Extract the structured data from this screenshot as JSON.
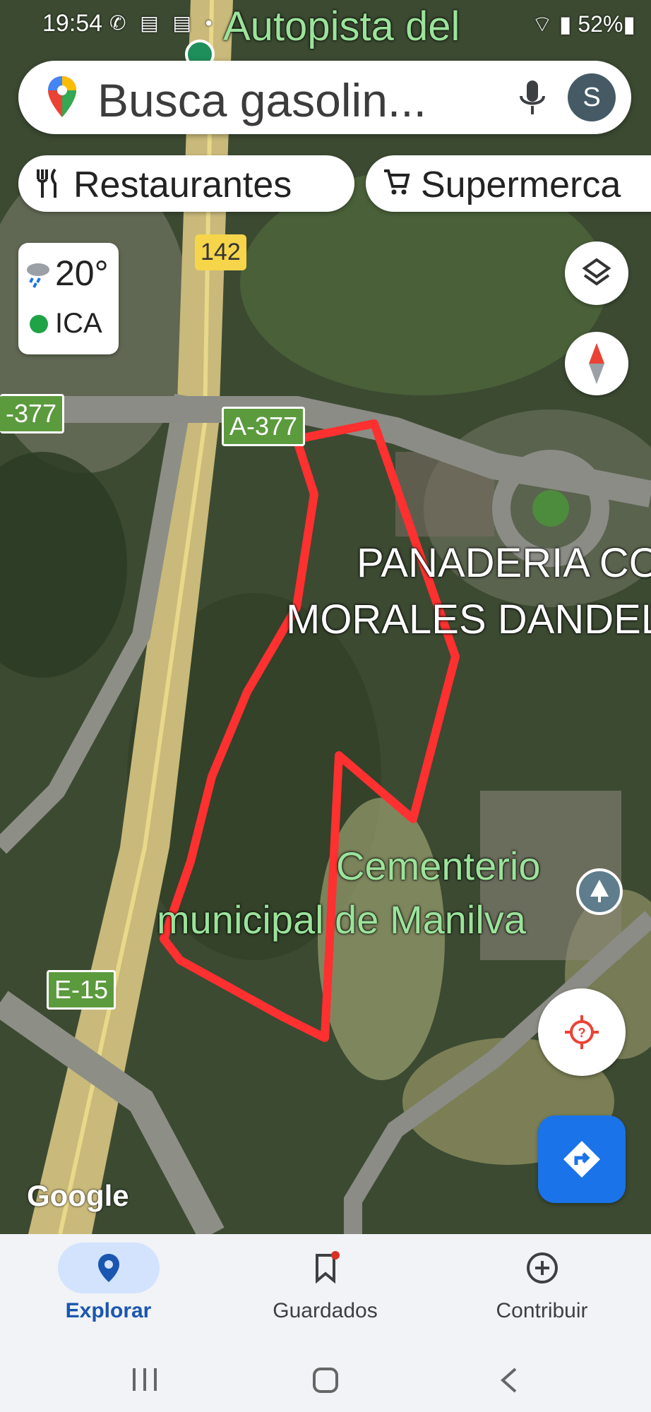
{
  "status_bar": {
    "time": "19:54",
    "battery": "52%"
  },
  "map_labels": {
    "top_road": "Autopista del",
    "bakery_line1": "PANADERIA CO",
    "bakery_line2": "MORALES DANDEL",
    "cemetery_line1": "Cementerio",
    "cemetery_line2": "municipal de Manilva"
  },
  "road_shields": {
    "a377_left": "-377",
    "a377_main": "A-377",
    "route_142": "142",
    "e15": "E-15"
  },
  "search": {
    "placeholder": "Busca gasolin...",
    "avatar_initial": "S"
  },
  "chips": [
    {
      "label": "Restaurantes",
      "icon": "fork-knife-icon"
    },
    {
      "label": "Supermerca",
      "icon": "shopping-cart-icon"
    }
  ],
  "weather": {
    "temperature": "20°",
    "air_quality": "ICA",
    "icon": "rain-cloud-icon",
    "air_quality_color": "#1ea446"
  },
  "attribution": "Google",
  "bottom_nav": [
    {
      "label": "Explorar",
      "icon": "location-pin-icon",
      "active": true,
      "color": "#1a56b0"
    },
    {
      "label": "Guardados",
      "icon": "bookmark-icon",
      "active": false
    },
    {
      "label": "Contribuir",
      "icon": "plus-circle-icon",
      "active": false
    }
  ],
  "colors": {
    "accent": "#1a73e8",
    "outline": "#ff3030"
  }
}
